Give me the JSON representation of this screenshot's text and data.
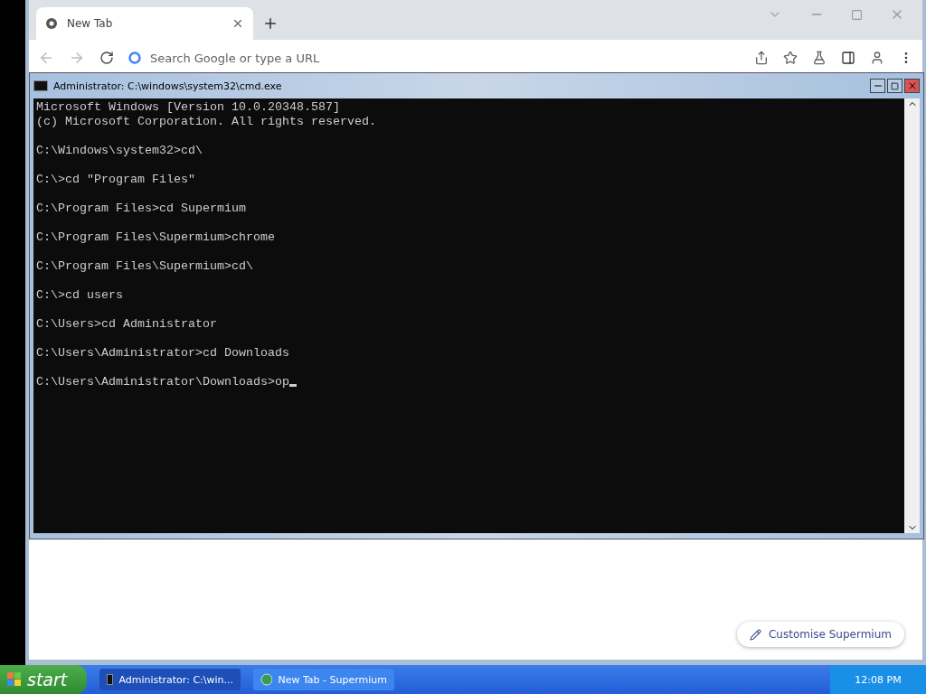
{
  "browser": {
    "tabs": [
      {
        "label": "New Tab",
        "selected": true
      }
    ],
    "address_bar": {
      "placeholder": "Search Google or type a URL"
    },
    "customise_button": {
      "label": "Customise Supermium"
    }
  },
  "console_window": {
    "title": "Administrator: C:\\windows\\system32\\cmd.exe",
    "blocks": [
      [
        "Microsoft Windows [Version 10.0.20348.587]",
        "(c) Microsoft Corporation. All rights reserved."
      ],
      [
        "C:\\Windows\\system32>cd\\"
      ],
      [
        "C:\\>cd \"Program Files\""
      ],
      [
        "C:\\Program Files>cd Supermium"
      ],
      [
        "C:\\Program Files\\Supermium>chrome"
      ],
      [
        "C:\\Program Files\\Supermium>cd\\"
      ],
      [
        "C:\\>cd users"
      ],
      [
        "C:\\Users>cd Administrator"
      ],
      [
        "C:\\Users\\Administrator>cd Downloads"
      ],
      [
        "C:\\Users\\Administrator\\Downloads>op"
      ]
    ]
  },
  "taskbar": {
    "start_label": "start",
    "items": [
      {
        "kind": "console",
        "label": "Administrator: C:\\win...",
        "selected": true
      },
      {
        "kind": "browser",
        "label": "New Tab - Supermium",
        "selected": false
      }
    ],
    "clock": "12:08 PM"
  }
}
